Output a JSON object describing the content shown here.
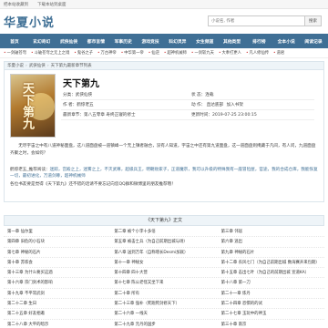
{
  "topbar": {
    "items": [
      "把本站收藏到",
      "下载本站到桌面"
    ]
  },
  "header": {
    "logo": "华夏小说",
    "search_placeholder": "小说名, 作者",
    "search_button": "搜索"
  },
  "nav": [
    "首页",
    "玄幻奇幻",
    "武侠仙侠",
    "都市言情",
    "军事历史",
    "游戏竞技",
    "科幻灵异",
    "女生频道",
    "其他类型",
    "排行榜",
    "全本小说",
    "阅读记录"
  ],
  "ticker": [
    "一剑破苍穹",
    "斗破苍穹之无上之境",
    "鬼谷之子",
    "万古神帝",
    "中华第一帝",
    "仙逆",
    "超神机械师",
    "一剑斩九天",
    "大奉打更人",
    "凡人修仙传",
    "道君"
  ],
  "breadcrumb": {
    "home": "华夏小说",
    "category": "武侠仙侠",
    "current": "天下第九最新章节列表"
  },
  "book": {
    "title": "天下第九",
    "category_label": "分类：",
    "category": "武侠仙侠",
    "status_label": "状 态：",
    "status": "连载",
    "author_label": "作 者：",
    "author": "鹤惊老五",
    "action_label": "动 作：",
    "action_read": "直达底部",
    "action_fav": "加入书架",
    "latest_label": "最新章节：",
    "latest": "第八五零章 寿终正寝的修士",
    "update_label": "更新时间：",
    "update": "2019-07-25 23:00:15",
    "desc": "　　无尽宇宙之中有八道神秘面盘，这八道面盘被一道镇峰一个无上镇者融合，没有人知道，宇宙之中还有第九道面盘，这一道面盘则掩藏于凡间，有人问，九道面盘齐聚之时，会如何？",
    "related_label": "鹤惊老五_推荐阅读：",
    "related": "迷踪，宫殿之上，迷雾之上，不灭武尊，超级兵王，明朝败家子，正道魔宗，我可以升级的特殊我有一座冒险屋，官途，我的合成仓库，我能恢复一切，最初进化，万道剑尊，超神机械师",
    "tip": "各位书友要是觉得《天下第九》还不错的话请不要忘记向您QQ群和微博里的朋友推荐哦！"
  },
  "chapter_header": "《天下第九》正文",
  "chapters": [
    [
      "第一章 仙尔里",
      "第二章 被个小李十多倍",
      "第三章 邻居"
    ],
    [
      "第四章 旧危的小石块",
      "第五章 被击士兵（为自己前期出城与场）",
      "第六章 逃出"
    ],
    [
      "第七章 神秘的石片",
      "第八章 送到万年（自称增长Desmi加就）",
      "第九章 神秘的石片"
    ],
    [
      "第十章 苏炼会",
      "第十一章 神秘女",
      "第十二章 农风七门（为自己前期出城 数海赛开来包期）"
    ],
    [
      "第十三章 为什么要买这酒",
      "第十四章 四十大营",
      "第十五章 击出七叶（为自己的前期出城 宣道KA）"
    ],
    [
      "第十六章 宗门剑术的影响",
      "第十七章 陈公老怪又坐下来",
      "第十八章 第一刀"
    ],
    [
      "第十九章 不平常武剑",
      "第二十章 所有",
      "第二十一章 炼丹"
    ],
    [
      "第二十二章 生日",
      "第二十三章 强补（死跑死剑修天下）",
      "第二十四章 恐惧的的试"
    ],
    [
      "第二十五章 好友相邀",
      "第二十六章 一线天",
      "第二十七章 玉玩中的神玉"
    ],
    [
      "第二十八章 大平的暗示",
      "第二十九章 元丹的国步",
      "第三十章 南京"
    ]
  ]
}
